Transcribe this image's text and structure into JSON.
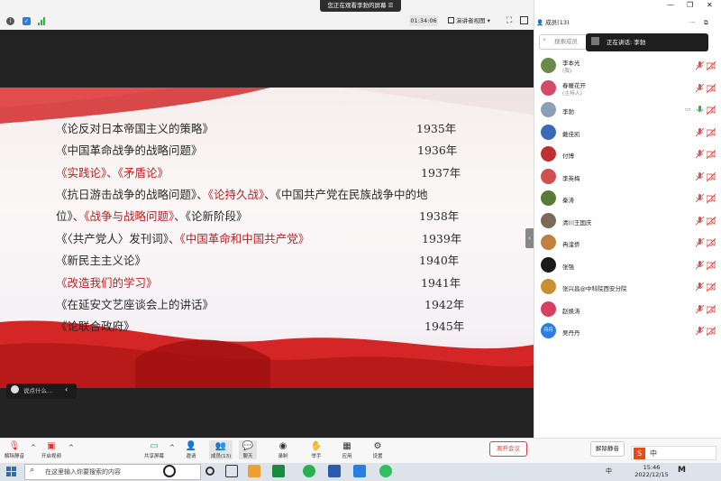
{
  "window": {
    "share_banner": "您正在观看李勃的屏幕",
    "timer": "01:34:06",
    "view_mode": "演讲者视图"
  },
  "slide": {
    "lines": [
      {
        "parts": [
          {
            "t": "《论反对日本帝国主义的策略》",
            "red": false
          }
        ],
        "year": "1935年"
      },
      {
        "parts": [
          {
            "t": "《中国革命战争的战略问题》",
            "red": false
          }
        ],
        "year": "1936年"
      },
      {
        "parts": [
          {
            "t": "《实践论》、《矛盾论》",
            "red": true
          }
        ],
        "year": "1937年"
      },
      {
        "parts": [
          {
            "t": "《抗日游击战争的战略问题》、",
            "red": false
          },
          {
            "t": "《论持久战》",
            "red": true
          },
          {
            "t": "、《中国共产党在民族战争中的地",
            "red": false
          }
        ],
        "year": ""
      },
      {
        "parts": [
          {
            "t": "位》、",
            "red": false
          },
          {
            "t": "《战争与战略问题》",
            "red": true
          },
          {
            "t": "、《论新阶段》",
            "red": false
          }
        ],
        "year": "1938年"
      },
      {
        "parts": [
          {
            "t": "《〈共产党人〉发刊词》、",
            "red": false
          },
          {
            "t": "《中国革命和中国共产党》",
            "red": true
          }
        ],
        "year": "1939年"
      },
      {
        "parts": [
          {
            "t": "《新民主主义论》",
            "red": false
          }
        ],
        "year": "1940年"
      },
      {
        "parts": [
          {
            "t": "《改造我们的学习》",
            "red": true
          }
        ],
        "year": "1941年"
      },
      {
        "parts": [
          {
            "t": "《在延安文艺座谈会上的讲话》",
            "red": false
          }
        ],
        "year": "1942年"
      },
      {
        "parts": [
          {
            "t": "《论联合政府》",
            "red": false
          }
        ],
        "year": "1945年"
      }
    ]
  },
  "chat_input": "说点什么...",
  "toolbar": {
    "unmute": "解除静音",
    "start_video": "开启视频",
    "share_screen": "共享屏幕",
    "invite": "邀请",
    "members": "成员(13)",
    "chat": "聊天",
    "record": "录制",
    "raise_hand": "举手",
    "apps": "应用",
    "settings": "设置",
    "leave": "离开会议"
  },
  "panel": {
    "title": "成员(13)",
    "search_placeholder": "搜索成员",
    "speaking": "正在讲话: 李勃",
    "mute_all": "解除静音",
    "members": [
      {
        "name": "李本光",
        "role": "(我)",
        "color": "#6b8a4a"
      },
      {
        "name": "春暖花开",
        "role": "(主持人)",
        "color": "#d44a6a"
      },
      {
        "name": "李勃",
        "role": "",
        "color": "#8aa0b8"
      },
      {
        "name": "戴佳凯",
        "role": "",
        "color": "#3a6ab8"
      },
      {
        "name": "付博",
        "role": "",
        "color": "#c03030"
      },
      {
        "name": "李英梅",
        "role": "",
        "color": "#d05050"
      },
      {
        "name": "秦涛",
        "role": "",
        "color": "#5a7a3a"
      },
      {
        "name": "清川王国庆",
        "role": "",
        "color": "#7a6a5a"
      },
      {
        "name": "冉淦侨",
        "role": "",
        "color": "#c08040"
      },
      {
        "name": "张强",
        "role": "",
        "color": "#1a1a1a"
      },
      {
        "name": "张兴昌@中科院西安分院",
        "role": "",
        "color": "#c89030"
      },
      {
        "name": "赵焕涛",
        "role": "",
        "color": "#d84060"
      },
      {
        "name": "吴丹丹",
        "role": "",
        "color": "#2a80e0",
        "initials": "丹丹"
      }
    ]
  },
  "taskbar": {
    "search_placeholder": "在这里输入你要搜索的内容",
    "time": "15:46",
    "date": "2022/12/15",
    "ime": "中"
  }
}
